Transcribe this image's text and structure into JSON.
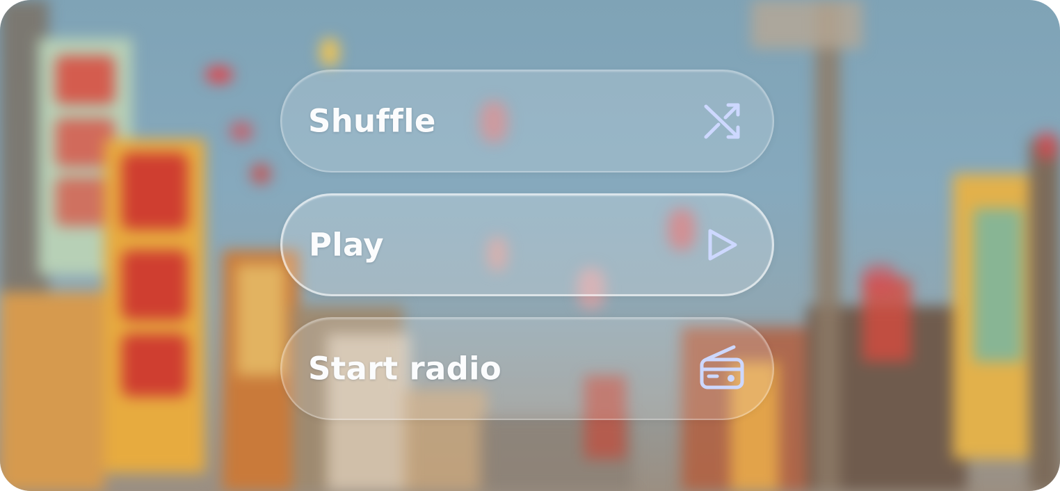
{
  "menu": {
    "items": [
      {
        "label": "Shuffle",
        "icon": "shuffle-icon"
      },
      {
        "label": "Play",
        "icon": "play-icon"
      },
      {
        "label": "Start radio",
        "icon": "radio-icon"
      }
    ],
    "active_index": 1
  },
  "colors": {
    "label": "#fbfcfd",
    "icon": "#cdd8ff",
    "sky": "#86a9bd",
    "sign_yellow": "#e7b148",
    "sign_red": "#d9483c",
    "sign_green": "#a4c8a6"
  }
}
